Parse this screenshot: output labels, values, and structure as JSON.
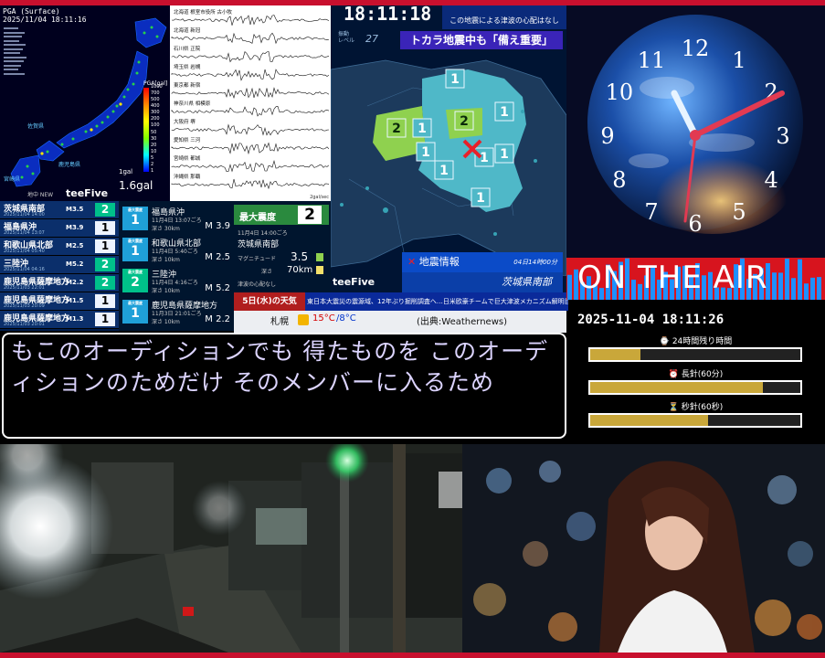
{
  "pga_panel": {
    "timestamp_line1": "PGA (Surface)",
    "timestamp_line2": "2025/11/04 18:11:16",
    "scale_title": "PGA[gal]",
    "scale_ticks": [
      "1000",
      "700",
      "500",
      "400",
      "300",
      "200",
      "100",
      "50",
      "30",
      "20",
      "10",
      "5",
      "2",
      "1"
    ],
    "gal_small": "1gal",
    "gal_big": "1.6gal",
    "tick_label": "地中 NEW",
    "map_labels": [
      "佐賀県",
      "鹿児島県",
      "宮崎県",
      "熊本県"
    ]
  },
  "seismograms": {
    "stations": [
      "北海道 根室市役所 古小牧",
      "北海道 新冠",
      "石川県 正院",
      "埼玉県 岩槻",
      "東京都 新宿",
      "神奈川県 相模原",
      "大阪府 堺",
      "愛知県 三河",
      "宮崎県 都城",
      "沖縄県 那覇"
    ],
    "unit": "2gal/sec"
  },
  "quake_list": {
    "logo": "teeFive",
    "items": [
      {
        "region": "茨城県南部",
        "date": "2025/11/04 14:00",
        "mag": "M3.5",
        "shindo": "2"
      },
      {
        "region": "福島県沖",
        "date": "2025/11/04 13:07",
        "mag": "M3.9",
        "shindo": "1"
      },
      {
        "region": "和歌山県北部",
        "date": "2025/11/04 05:40",
        "mag": "M2.5",
        "shindo": "1"
      },
      {
        "region": "三陸沖",
        "date": "2025/11/04 04:16",
        "mag": "M5.2",
        "shindo": "2"
      },
      {
        "region": "鹿児島県薩摩地方",
        "date": "2025/11/03 22:01",
        "mag": "M2.2",
        "shindo": "2"
      },
      {
        "region": "鹿児島県薩摩地方",
        "date": "2025/11/03 20:09",
        "mag": "M1.5",
        "shindo": "1"
      },
      {
        "region": "鹿児島県薩摩地方",
        "date": "2025/11/03 20:01",
        "mag": "M1.3",
        "shindo": "1"
      }
    ]
  },
  "quake_detail": {
    "badge_label": "最大震度",
    "items": [
      {
        "shindo": "1",
        "region": "福島県沖",
        "time": "11月4日 13:07ごろ",
        "depth": "深さ 30km",
        "mag": "M 3.9"
      },
      {
        "shindo": "1",
        "region": "和歌山県北部",
        "time": "11月4日 5:40ごろ",
        "depth": "深さ 10km",
        "mag": "M 2.5"
      },
      {
        "shindo": "2",
        "region": "三陸沖",
        "time": "11月4日 4:16ごろ",
        "depth": "深さ 10km",
        "mag": "M 5.2"
      },
      {
        "shindo": "1",
        "region": "鹿児島県薩摩地方",
        "time": "11月3日 21:01ごろ",
        "depth": "深さ 10km",
        "mag": "M 2.2"
      }
    ]
  },
  "max_shindo": {
    "label": "最大震度",
    "value": "2",
    "time": "11月4日 14:00ごろ",
    "region": "茨城県南部",
    "magnitude_label": "マグニチュード",
    "magnitude": "3.5",
    "depth_label": "深さ",
    "depth": "70km",
    "tsunami_note": "津波の心配なし"
  },
  "regional_map": {
    "clock": "18:11:18",
    "level_label_top": "振動",
    "level_label_bottom": "レベル",
    "level_value": "27",
    "tsunami_note": "この地震による津波の心配はなし",
    "headline": "トカラ地震中も「備え重要」",
    "logo": "teeFive",
    "info_title": "地震情報",
    "info_time": "04日14時00分",
    "info_location": "茨城県南部",
    "intensity_markers": [
      "1",
      "1",
      "1",
      "2",
      "2",
      "1",
      "1",
      "1",
      "1",
      "1"
    ],
    "colors": {
      "shindo1": "#4fb8c8",
      "shindo2": "#8fd14f",
      "land": "#1c3a5c",
      "sea": "#001433",
      "epicenter": "#e8202a"
    }
  },
  "weather": {
    "day": "5日(水)の天気",
    "news": "東日本大震災の震源域、12年ぶり掘削調査へ…日米欧豪チームで巨大津波メカニズム解明目指す",
    "city": "札幌",
    "high": "15°C",
    "low": "/8°C",
    "source": "(出典:Weathernews)"
  },
  "clock_panel": {
    "numerals": [
      "12",
      "1",
      "2",
      "3",
      "4",
      "5",
      "6",
      "7",
      "8",
      "9",
      "10",
      "11"
    ],
    "onair": "ON THE AIR",
    "datetime": "2025-11-04 18:11:26"
  },
  "progress": [
    {
      "label": "24時間残り時間",
      "fraction": 0.24
    },
    {
      "label": "長針(60分)",
      "fraction": 0.82
    },
    {
      "label": "秒針(60秒)",
      "fraction": 0.56
    }
  ],
  "subtitle": {
    "text": "もこのオーディションでも 得たものを このオーディションのためだけ そのメンバーに入るため"
  },
  "colors": {
    "frame": "#c8102e",
    "accent_blue": "#0b4bc8",
    "onair_red": "#d7141e",
    "subtitle_text": "#dcd4ff",
    "progress_gold": "#c9a73a"
  }
}
